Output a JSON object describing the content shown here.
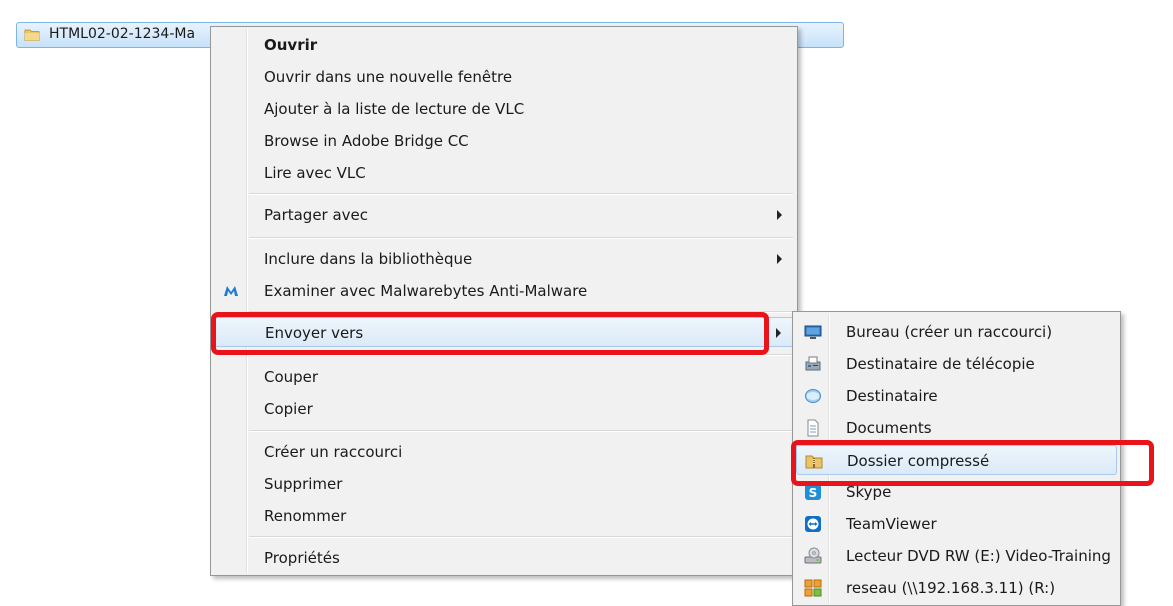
{
  "file": {
    "name": "HTML02-02-1234-Ma"
  },
  "context_menu": {
    "items": [
      {
        "label": "Ouvrir"
      },
      {
        "label": "Ouvrir dans une nouvelle fenêtre"
      },
      {
        "label": "Ajouter à la liste de lecture de VLC"
      },
      {
        "label": "Browse in Adobe Bridge CC"
      },
      {
        "label": "Lire avec VLC"
      },
      {
        "label": "Partager avec"
      },
      {
        "label": "Inclure dans la bibliothèque"
      },
      {
        "label": "Examiner avec Malwarebytes Anti-Malware"
      },
      {
        "label": "Envoyer vers"
      },
      {
        "label": "Couper"
      },
      {
        "label": "Copier"
      },
      {
        "label": "Créer un raccourci"
      },
      {
        "label": "Supprimer"
      },
      {
        "label": "Renommer"
      },
      {
        "label": "Propriétés"
      }
    ]
  },
  "send_to_menu": {
    "items": [
      {
        "label": "Bureau (créer un raccourci)",
        "icon": "desktop-icon"
      },
      {
        "label": "Destinataire de télécopie",
        "icon": "fax-icon"
      },
      {
        "label": "Destinataire",
        "icon": "mail-icon"
      },
      {
        "label": "Documents",
        "icon": "documents-icon"
      },
      {
        "label": "Dossier compressé",
        "icon": "zip-folder-icon"
      },
      {
        "label": "Skype",
        "icon": "skype-icon"
      },
      {
        "label": "TeamViewer",
        "icon": "teamviewer-icon"
      },
      {
        "label": "Lecteur DVD RW (E:) Video-Training",
        "icon": "dvd-drive-icon"
      },
      {
        "label": "reseau (\\\\192.168.3.11) (R:)",
        "icon": "network-drive-icon"
      }
    ]
  },
  "colors": {
    "highlight": "#e8141a",
    "menu_bg": "#f1f1f1",
    "selection": "#c7e2fa"
  }
}
